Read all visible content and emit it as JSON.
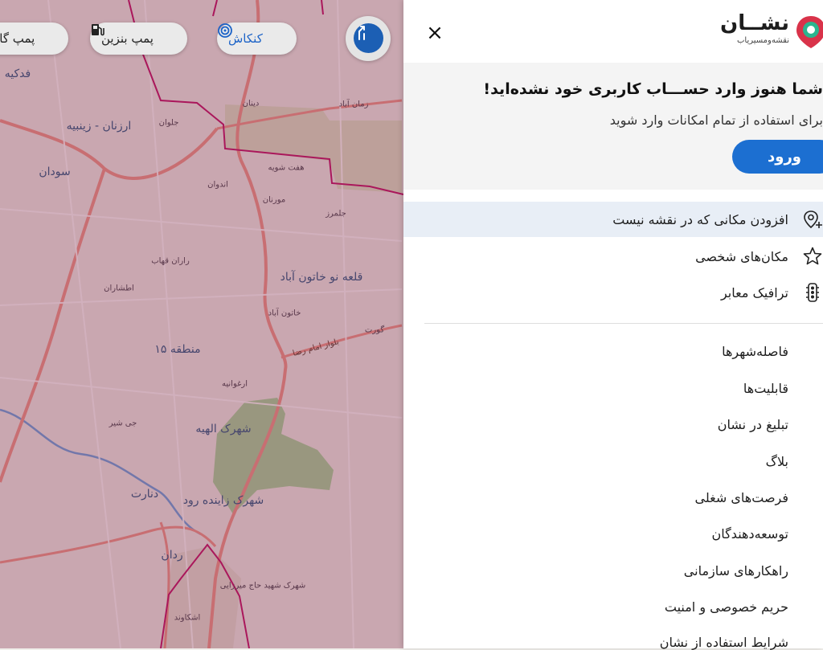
{
  "app": {
    "brand_name": "نشــان",
    "brand_tagline": "نقشه‌ومسیریاب",
    "close_glyph": "×"
  },
  "chips": [
    {
      "label": "کنکاش",
      "icon": "radar-icon",
      "active": true
    },
    {
      "label": "پمپ بنزین",
      "icon": "fuel-pump-icon",
      "active": false
    },
    {
      "label": "پمپ گاز",
      "icon": "cng-pump-icon",
      "active": false
    }
  ],
  "login": {
    "title": "شما هنوز وارد حســـاب کاربری خود نشده‌اید!",
    "subtitle": "برای استفاده از تمام امکانات وارد شوید",
    "button_label": "ورود"
  },
  "menu": [
    {
      "label": "افزودن مکانی که در نقشه نیست",
      "icon": "add-location-icon"
    },
    {
      "label": "مکان‌های شخصی",
      "icon": "star-icon"
    },
    {
      "label": "ترافیک معابر",
      "icon": "traffic-light-icon"
    }
  ],
  "links": [
    "فاصله‌شهرها",
    "قابلیت‌ها",
    "تبلیغ در نشان",
    "بلاگ",
    "فرصت‌های شغلی",
    "توسعه‌دهندگان",
    "راهکارهای سازمانی",
    "حریم خصوصی و امنیت",
    "شرایط استفاده از نشان"
  ],
  "map_labels": {
    "fadakiyeh": "فدکیه",
    "arzanan": "ارزنان - زینبیه",
    "jolvan": "جلوان",
    "dinan": "دینان",
    "zamanabad": "زمان آباد",
    "sudan": "سودان",
    "haftshuyeh": "هفت شویه",
    "andvan": "اندوان",
    "murnan": "مورنان",
    "jalmarz": "جلمرز",
    "raranghahab": "راران قهاب",
    "eteshran": "اطشاران",
    "ghalehno": "قلعه نو خاتون آباد",
    "khatunabad": "خاتون آباد",
    "gort": "گورت",
    "region15": "منطقه ۱۵",
    "blvd": "بلوار امام رضا",
    "arghvanieh": "ارغوانیه",
    "jishir": "جی شیر",
    "elahiyeh": "شهرک الهیه",
    "denart": "دنارت",
    "zayandehrud": "شهرک زاینده رود",
    "radan": "ردان",
    "hajmirzaei": "شهرک شهید حاج میرزایی",
    "eshkavand": "اشکاوند"
  }
}
